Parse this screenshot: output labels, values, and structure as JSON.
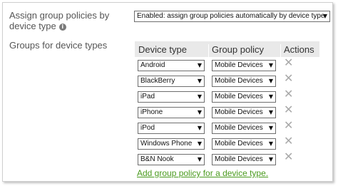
{
  "assign": {
    "label": "Assign group policies by device type",
    "info_icon": "info-icon",
    "selected": "Enabled: assign group policies automatically by device type"
  },
  "groups": {
    "label": "Groups for device types",
    "columns": [
      "Device type",
      "Group policy",
      "Actions"
    ],
    "rows": [
      {
        "device": "Android",
        "policy": "Mobile Devices"
      },
      {
        "device": "BlackBerry",
        "policy": "Mobile Devices"
      },
      {
        "device": "iPad",
        "policy": "Mobile Devices"
      },
      {
        "device": "iPhone",
        "policy": "Mobile Devices"
      },
      {
        "device": "iPod",
        "policy": "Mobile Devices"
      },
      {
        "device": "Windows Phone",
        "policy": "Mobile Devices"
      },
      {
        "device": "B&N Nook",
        "policy": "Mobile Devices"
      }
    ],
    "delete_icon": "close-icon",
    "add_link": "Add group policy for a device type."
  },
  "colors": {
    "link": "#4a9a1e",
    "header_bg": "#e9e9e9",
    "delete_icon": "#a9a9a9"
  }
}
